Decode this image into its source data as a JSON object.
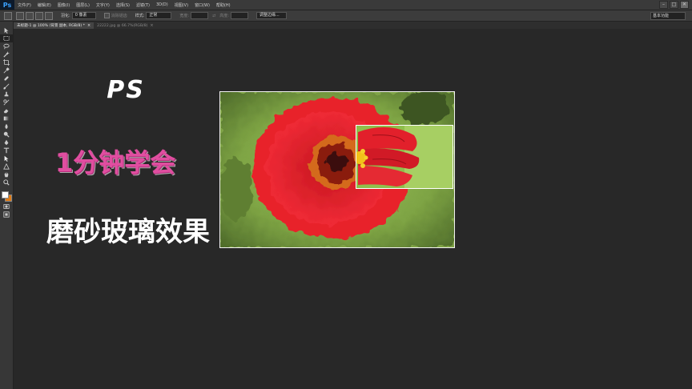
{
  "app": {
    "logo": "Ps"
  },
  "menu": [
    "文件(F)",
    "编辑(E)",
    "图像(I)",
    "图层(L)",
    "文字(Y)",
    "选择(S)",
    "滤镜(T)",
    "3D(D)",
    "视图(V)",
    "窗口(W)",
    "帮助(H)"
  ],
  "window_controls": [
    "–",
    "□",
    "✕"
  ],
  "options": {
    "feather_label": "羽化:",
    "feather_value": "0 像素",
    "antialias_label": "消除锯齿",
    "style_label": "样式:",
    "style_value": "正常",
    "width_label": "宽度:",
    "height_label": "高度:",
    "refine_edge_label": "调整边缘...",
    "workspace": "基本功能"
  },
  "tabs": [
    {
      "label": "未标题-1 @ 100% (背景 副本, RGB/8) *",
      "close": "×"
    },
    {
      "label": "22222.jpg @ 66.7%(RGB/8)",
      "close": "×"
    }
  ],
  "canvas": {
    "title_ps": "PS",
    "title_minute": "1分钟学会",
    "title_effect": "磨砂玻璃效果"
  },
  "colors": {
    "foreground": "#ffffff",
    "background": "#e07b14",
    "accent_pink": "#e04ea0",
    "flower_red": "#e8202c"
  },
  "toolbar_icons": [
    "move-icon",
    "marquee-icon",
    "lasso-icon",
    "magic-wand-icon",
    "crop-icon",
    "eyedropper-icon",
    "healing-brush-icon",
    "brush-icon",
    "clone-stamp-icon",
    "history-brush-icon",
    "eraser-icon",
    "gradient-icon",
    "blur-icon",
    "dodge-icon",
    "pen-icon",
    "type-icon",
    "path-selection-icon",
    "shape-icon",
    "hand-icon",
    "zoom-icon"
  ]
}
